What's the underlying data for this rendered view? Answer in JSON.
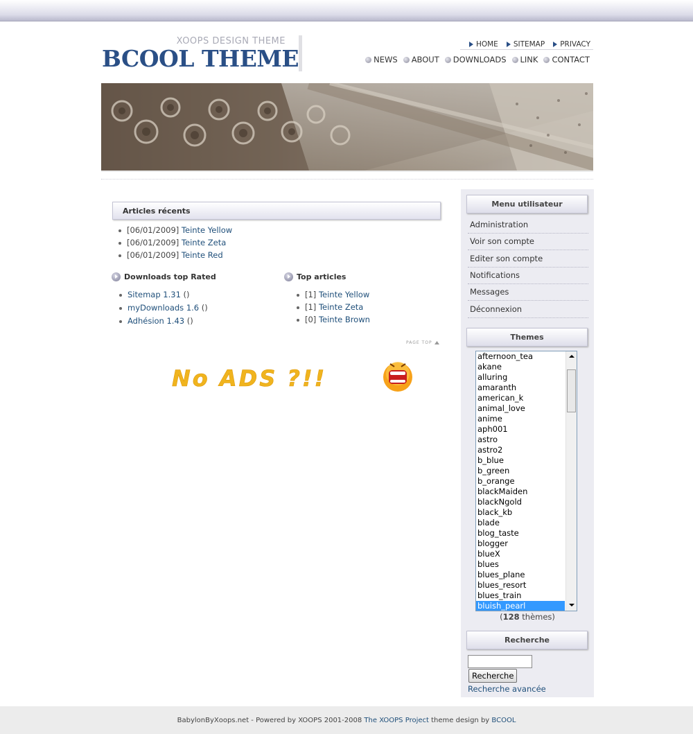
{
  "header": {
    "logo_subtitle": "XOOPS DESIGN THEME",
    "logo_title": "BCOOL THEME",
    "nav_top": [
      "HOME",
      "SITEMAP",
      "PRIVACY"
    ],
    "nav_main": [
      "NEWS",
      "ABOUT",
      "DOWNLOADS",
      "LINK",
      "CONTACT"
    ]
  },
  "main": {
    "recent_articles": {
      "title": "Articles récents",
      "items": [
        {
          "date": "[06/01/2009]",
          "link": "Teinte Yellow"
        },
        {
          "date": "[06/01/2009]",
          "link": "Teinte Zeta"
        },
        {
          "date": "[06/01/2009]",
          "link": "Teinte Red"
        }
      ]
    },
    "downloads": {
      "title": "Downloads top Rated",
      "items": [
        {
          "link": "Sitemap 1.31",
          "suffix": " ()"
        },
        {
          "link": "myDownloads 1.6",
          "suffix": " ()"
        },
        {
          "link": "Adhésion 1.43",
          "suffix": " ()"
        }
      ]
    },
    "top_articles": {
      "title": "Top articles",
      "items": [
        {
          "count": "[1]",
          "link": "Teinte Yellow"
        },
        {
          "count": "[1]",
          "link": "Teinte Zeta"
        },
        {
          "count": "[0]",
          "link": "Teinte Brown"
        }
      ]
    },
    "page_top": "PAGE TOP",
    "ad_text": "No ADS ?!!"
  },
  "sidebar": {
    "user_menu": {
      "title": "Menu utilisateur",
      "items": [
        "Administration",
        "Voir son compte",
        "Editer son compte",
        "Notifications",
        "Messages",
        "Déconnexion"
      ]
    },
    "themes": {
      "title": "Themes",
      "options": [
        "afternoon_tea",
        "akane",
        "alluring",
        "amaranth",
        "american_k",
        "animal_love",
        "anime",
        "aph001",
        "astro",
        "astro2",
        "b_blue",
        "b_green",
        "b_orange",
        "blackMaiden",
        "blackNgold",
        "black_kb",
        "blade",
        "blog_taste",
        "blogger",
        "blueX",
        "blues",
        "blues_plane",
        "blues_resort",
        "blues_train",
        "bluish_pearl"
      ],
      "selected": "bluish_pearl",
      "count_prefix": "(",
      "count": "128",
      "count_suffix": " thèmes)"
    },
    "search": {
      "title": "Recherche",
      "input_value": "",
      "button_label": "Recherche",
      "advanced_link": "Recherche avancée"
    }
  },
  "footer": {
    "text_1": "BabylonByXoops.net - Powered by XOOPS 2001-2008 ",
    "link_1": "The XOOPS Project",
    "text_2": " theme design by ",
    "link_2": "BCOOL"
  },
  "colors": {
    "brand_blue": "#2a4f86",
    "link": "#1f4f7a",
    "selection": "#3399ff"
  }
}
